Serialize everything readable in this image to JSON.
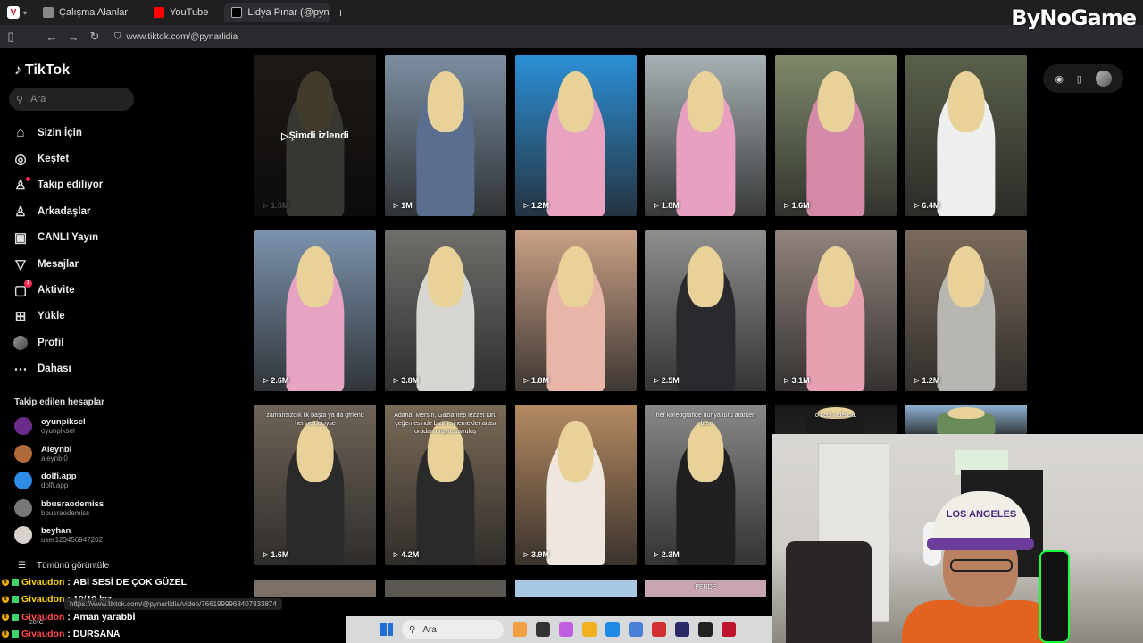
{
  "browser": {
    "tabs": [
      {
        "label": "Çalışma Alanları",
        "icon": "workspaces-icon",
        "color": "#888888"
      },
      {
        "label": "YouTube",
        "icon": "youtube-icon",
        "color": "#ff0000"
      },
      {
        "label": "Lidya Pınar (@pynarlidia) |",
        "icon": "tiktok-icon",
        "color": "#000000",
        "active": true
      }
    ],
    "new_tab": "+",
    "url": "www.tiktok.com/@pynarlidia"
  },
  "overlay_brand": "ByNoGame",
  "sidebar": {
    "logo": "TikTok",
    "search_placeholder": "Ara",
    "menu": [
      {
        "label": "Sizin İçin",
        "icon": "home-icon",
        "glyph": "⌂"
      },
      {
        "label": "Keşfet",
        "icon": "compass-icon",
        "glyph": "◎"
      },
      {
        "label": "Takip ediliyor",
        "icon": "following-icon",
        "glyph": "♙"
      },
      {
        "label": "Arkadaşlar",
        "icon": "friends-icon",
        "glyph": "♙"
      },
      {
        "label": "CANLI Yayın",
        "icon": "live-icon",
        "glyph": "▣"
      },
      {
        "label": "Mesajlar",
        "icon": "messages-icon",
        "glyph": "▽"
      },
      {
        "label": "Aktivite",
        "icon": "activity-icon",
        "glyph": "▢",
        "badge": "1"
      },
      {
        "label": "Yükle",
        "icon": "upload-icon",
        "glyph": "⊞"
      },
      {
        "label": "Profil",
        "icon": "profile-icon",
        "glyph": "●"
      },
      {
        "label": "Dahası",
        "icon": "more-icon",
        "glyph": "⋯"
      }
    ],
    "following_title": "Takip edilen hesaplar",
    "following": [
      {
        "name": "oyunpiksel",
        "user": "oyunpiksel",
        "color": "#6a2c8a"
      },
      {
        "name": "Aleynbl",
        "user": "aleynbl0",
        "color": "#b06a3a"
      },
      {
        "name": "dolfi.app",
        "user": "dolfi.app",
        "color": "#2e8be6"
      },
      {
        "name": "bbusraodemiss",
        "user": "bbusraodemiss",
        "color": "#777777"
      },
      {
        "name": "beyhan",
        "user": "user123456947262",
        "color": "#d9d2cc"
      }
    ],
    "see_all": "Tümünü görüntüle"
  },
  "videos": [
    {
      "views": "1.6M",
      "watched": true,
      "watched_label": "Şimdi izlendi",
      "bg": "#6b5a4c",
      "fig": "#c9c2b8"
    },
    {
      "views": "1M",
      "bg": "#7b8ea0",
      "fig": "#5a6f8f"
    },
    {
      "views": "1.2M",
      "bg": "#2d8fd6",
      "fig": "#e8a3c0"
    },
    {
      "views": "1.8M",
      "bg": "#a7b0b4",
      "fig": "#e8a0c0"
    },
    {
      "views": "1.6M",
      "bg": "#7e8a6a",
      "fig": "#d48aa8"
    },
    {
      "views": "6.4M",
      "bg": "#596049",
      "fig": "#eeeeee"
    },
    {
      "views": "2.6M",
      "bg": "#7c93ad",
      "fig": "#e6a3c2"
    },
    {
      "views": "3.8M",
      "bg": "#6f6e6b",
      "fig": "#d8d6d2"
    },
    {
      "views": "1.8M",
      "bg": "#c9a186",
      "fig": "#e7b6a8"
    },
    {
      "views": "2.5M",
      "bg": "#8d8f8c",
      "fig": "#2a2a2e"
    },
    {
      "views": "3.1M",
      "bg": "#91837d",
      "fig": "#e6a0b0"
    },
    {
      "views": "1.2M",
      "bg": "#7a6a5b",
      "fig": "#b8b6b0"
    },
    {
      "views": "1.6M",
      "bg": "#6e6358",
      "fig": "#2b2a2a",
      "caption": "zamansızdık ilk başta ya da gfriend her ne deciyse"
    },
    {
      "views": "4.2M",
      "bg": "#7a6a56",
      "fig": "#2a2a2a",
      "caption": "Adana, Mersin, Gaziantep lezzet turu çeğemesinde bizim sinemekler arası oradan oraya savruluş"
    },
    {
      "views": "3.9M",
      "bg": "#b48a62",
      "fig": "#efe7df"
    },
    {
      "views": "2.3M",
      "bg": "#888888",
      "fig": "#202020",
      "caption": "her koreografide dünya turu atarken ben"
    },
    {
      "views": "",
      "bg": "#1a1a1a",
      "fig": "#1a1a1a",
      "caption": "o kedi videosu."
    },
    {
      "views": "",
      "bg": "#8fb4d6",
      "fig": "#6a8a5a"
    }
  ],
  "bottom_partial": [
    {
      "bg": "#7a7068",
      "label": ""
    },
    {
      "bg": "#5a5652",
      "label": ""
    },
    {
      "bg": "#a8c8e6",
      "label": ""
    },
    {
      "bg": "#c7a6b0",
      "label": "PERDE"
    }
  ],
  "webcam": {
    "cap_text": "LOS ANGELES"
  },
  "chat": [
    {
      "user": "Givaudon",
      "msg": "ABİ SESİ DE ÇOK GÜZEL",
      "red": false
    },
    {
      "user": "Givaudon",
      "msg": "10/10 kız",
      "red": false
    },
    {
      "user": "Givaudon",
      "msg": "Aman yarabbİ",
      "red": true
    },
    {
      "user": "Givaudon",
      "msg": "DURSANA",
      "red": true
    }
  ],
  "status_url": "https://www.tiktok.com/@pynarlidia/video/7661999968407833874",
  "weather": "28°C",
  "taskbar": {
    "search_placeholder": "Ara",
    "apps": [
      "#f0a040",
      "#333333",
      "#c060e0",
      "#f0b020",
      "#1e88e5",
      "#4a7fd6",
      "#d03030",
      "#2b2b6a",
      "#222222",
      "#c0142d"
    ]
  }
}
